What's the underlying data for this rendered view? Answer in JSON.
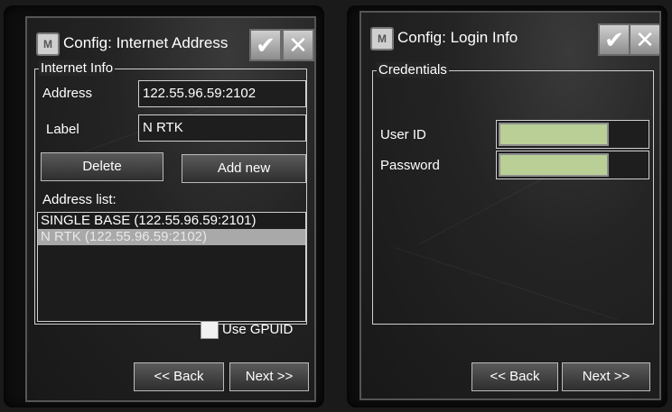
{
  "left": {
    "title": "Config: Internet Address",
    "app_icon": "M",
    "ok_icon": "checkmark-icon",
    "close_icon": "close-icon",
    "group_title": "Internet Info",
    "address_label": "Address",
    "address_value": "122.55.96.59:2102",
    "label_label": "Label",
    "label_value": "N RTK",
    "delete_label": "Delete",
    "add_new_label": "Add new",
    "address_list_label": "Address list:",
    "address_list": [
      "SINGLE BASE (122.55.96.59:2101)",
      "N RTK (122.55.96.59:2102)"
    ],
    "selected_index": 1,
    "use_gpuid_label": "Use GPUID",
    "back_label": "<< Back",
    "next_label": "Next >>"
  },
  "right": {
    "title": "Config: Login Info",
    "app_icon": "M",
    "group_title": "Credentials",
    "user_id_label": "User ID",
    "password_label": "Password",
    "back_label": "<< Back",
    "next_label": "Next >>"
  },
  "colors": {
    "input_highlight": "#b9cf96",
    "selected_row": "#a9a9a9"
  }
}
